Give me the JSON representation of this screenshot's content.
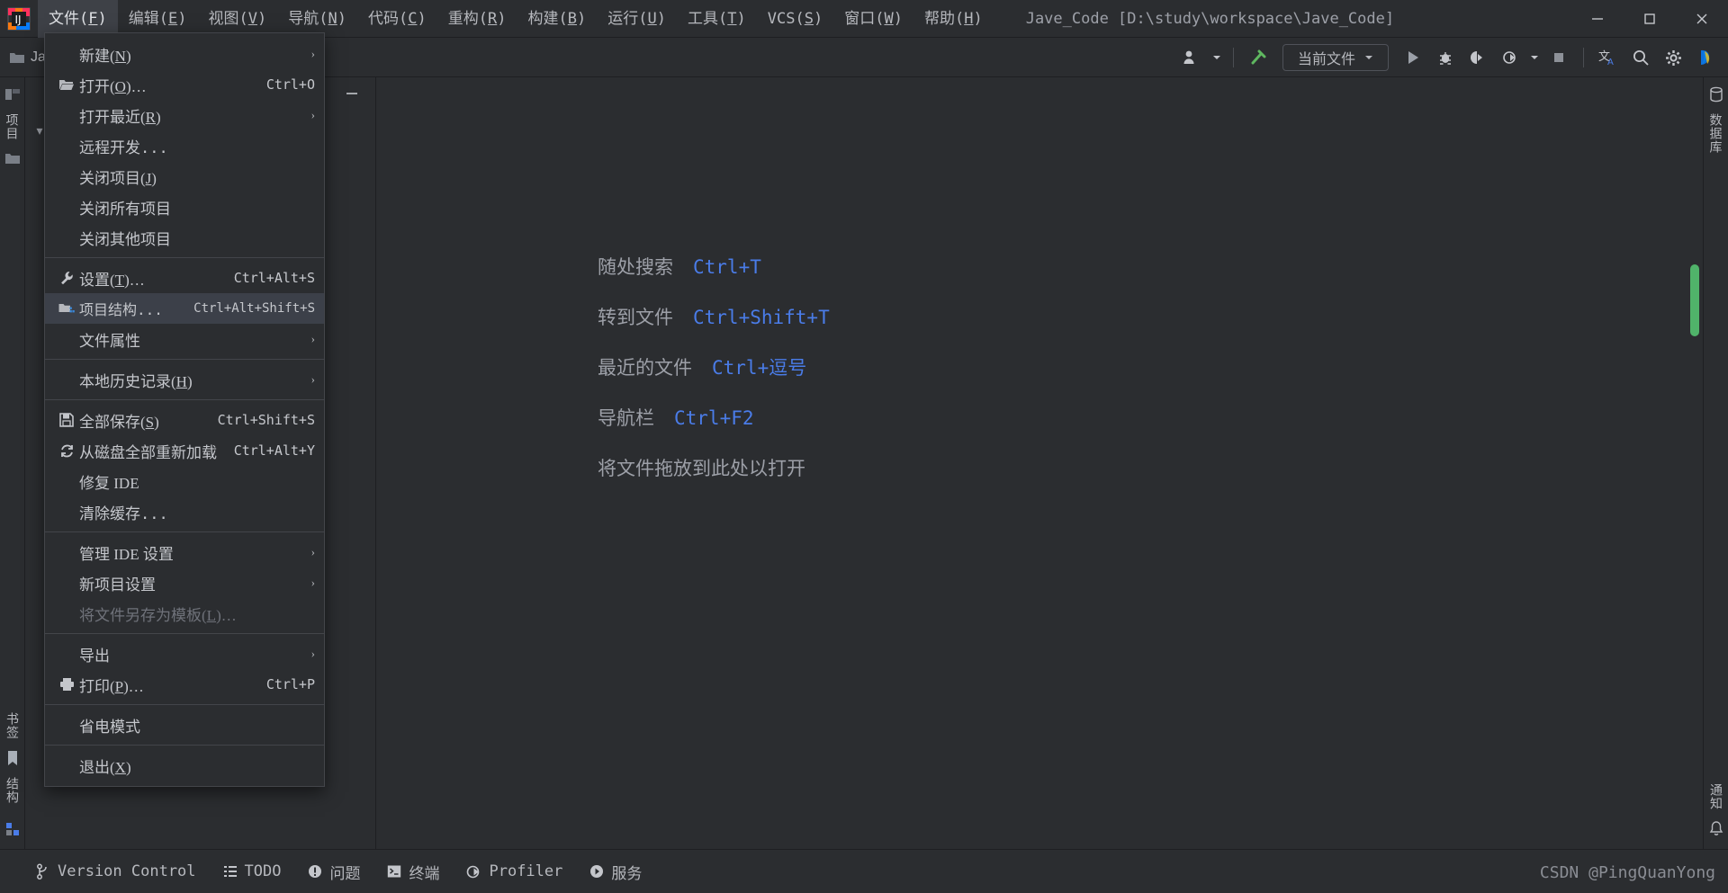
{
  "window": {
    "title": "Jave_Code [D:\\study\\workspace\\Jave_Code]",
    "minimize_label": "—",
    "maximize_label": "▭",
    "close_label": "✕"
  },
  "menubar": {
    "items": [
      {
        "label": "文件(F)",
        "text": "文件(",
        "mnemonic": "F",
        "tail": ")",
        "active": true
      },
      {
        "label": "编辑(E)",
        "text": "编辑(",
        "mnemonic": "E",
        "tail": ")",
        "active": false
      },
      {
        "label": "视图(V)",
        "text": "视图(",
        "mnemonic": "V",
        "tail": ")",
        "active": false
      },
      {
        "label": "导航(N)",
        "text": "导航(",
        "mnemonic": "N",
        "tail": ")",
        "active": false
      },
      {
        "label": "代码(C)",
        "text": "代码(",
        "mnemonic": "C",
        "tail": ")",
        "active": false
      },
      {
        "label": "重构(R)",
        "text": "重构(",
        "mnemonic": "R",
        "tail": ")",
        "active": false
      },
      {
        "label": "构建(B)",
        "text": "构建(",
        "mnemonic": "B",
        "tail": ")",
        "active": false
      },
      {
        "label": "运行(U)",
        "text": "运行(",
        "mnemonic": "U",
        "tail": ")",
        "active": false
      },
      {
        "label": "工具(T)",
        "text": "工具(",
        "mnemonic": "T",
        "tail": ")",
        "active": false
      },
      {
        "label": "VCS(S)",
        "text": "VCS(",
        "mnemonic": "S",
        "tail": ")",
        "active": false
      },
      {
        "label": "窗口(W)",
        "text": "窗口(",
        "mnemonic": "W",
        "tail": ")",
        "active": false
      },
      {
        "label": "帮助(H)",
        "text": "帮助(",
        "mnemonic": "H",
        "tail": ")",
        "active": false
      }
    ]
  },
  "file_menu": {
    "items": [
      {
        "label": "新建(N)",
        "pre": "新建(",
        "mn": "N",
        "post": ")",
        "shortcut": "",
        "arrow": true,
        "icon": "",
        "disabled": false,
        "highlight": false,
        "sep_after": false
      },
      {
        "label": "打开(O)…",
        "pre": "打开(",
        "mn": "O",
        "post": ")…",
        "shortcut": "Ctrl+O",
        "arrow": false,
        "icon": "folder-open-icon",
        "disabled": false,
        "highlight": false,
        "sep_after": false
      },
      {
        "label": "打开最近(R)",
        "pre": "打开最近(",
        "mn": "R",
        "post": ")",
        "shortcut": "",
        "arrow": true,
        "icon": "",
        "disabled": false,
        "highlight": false,
        "sep_after": false
      },
      {
        "label": "远程开发...",
        "pre": "远程开发...",
        "mn": "",
        "post": "",
        "shortcut": "",
        "arrow": false,
        "icon": "",
        "disabled": false,
        "highlight": false,
        "sep_after": false
      },
      {
        "label": "关闭项目(J)",
        "pre": "关闭项目(",
        "mn": "J",
        "post": ")",
        "shortcut": "",
        "arrow": false,
        "icon": "",
        "disabled": false,
        "highlight": false,
        "sep_after": false
      },
      {
        "label": "关闭所有项目",
        "pre": "关闭所有项目",
        "mn": "",
        "post": "",
        "shortcut": "",
        "arrow": false,
        "icon": "",
        "disabled": false,
        "highlight": false,
        "sep_after": false
      },
      {
        "label": "关闭其他项目",
        "pre": "关闭其他项目",
        "mn": "",
        "post": "",
        "shortcut": "",
        "arrow": false,
        "icon": "",
        "disabled": false,
        "highlight": false,
        "sep_after": true
      },
      {
        "label": "设置(T)…",
        "pre": "设置(",
        "mn": "T",
        "post": ")…",
        "shortcut": "Ctrl+Alt+S",
        "arrow": false,
        "icon": "wrench-icon",
        "disabled": false,
        "highlight": false,
        "sep_after": false
      },
      {
        "label": "项目结构...",
        "pre": "项目结构...",
        "mn": "",
        "post": "",
        "shortcut": "Ctrl+Alt+Shift+S",
        "arrow": false,
        "icon": "project-structure-icon",
        "disabled": false,
        "highlight": true,
        "sep_after": false
      },
      {
        "label": "文件属性",
        "pre": "文件属性",
        "mn": "",
        "post": "",
        "shortcut": "",
        "arrow": true,
        "icon": "",
        "disabled": false,
        "highlight": false,
        "sep_after": true
      },
      {
        "label": "本地历史记录(H)",
        "pre": "本地历史记录(",
        "mn": "H",
        "post": ")",
        "shortcut": "",
        "arrow": true,
        "icon": "",
        "disabled": false,
        "highlight": false,
        "sep_after": true
      },
      {
        "label": "全部保存(S)",
        "pre": "全部保存(",
        "mn": "S",
        "post": ")",
        "shortcut": "Ctrl+Shift+S",
        "arrow": false,
        "icon": "save-icon",
        "disabled": false,
        "highlight": false,
        "sep_after": false
      },
      {
        "label": "从磁盘全部重新加载",
        "pre": "从磁盘全部重新加载",
        "mn": "",
        "post": "",
        "shortcut": "Ctrl+Alt+Y",
        "arrow": false,
        "icon": "reload-icon",
        "disabled": false,
        "highlight": false,
        "sep_after": false
      },
      {
        "label": "修复 IDE",
        "pre": "修复 IDE",
        "mn": "",
        "post": "",
        "shortcut": "",
        "arrow": false,
        "icon": "",
        "disabled": false,
        "highlight": false,
        "sep_after": false
      },
      {
        "label": "清除缓存...",
        "pre": "清除缓存...",
        "mn": "",
        "post": "",
        "shortcut": "",
        "arrow": false,
        "icon": "",
        "disabled": false,
        "highlight": false,
        "sep_after": true
      },
      {
        "label": "管理 IDE 设置",
        "pre": "管理 IDE 设置",
        "mn": "",
        "post": "",
        "shortcut": "",
        "arrow": true,
        "icon": "",
        "disabled": false,
        "highlight": false,
        "sep_after": false
      },
      {
        "label": "新项目设置",
        "pre": "新项目设置",
        "mn": "",
        "post": "",
        "shortcut": "",
        "arrow": true,
        "icon": "",
        "disabled": false,
        "highlight": false,
        "sep_after": false
      },
      {
        "label": "将文件另存为模板(L)…",
        "pre": "将文件另存为模板(",
        "mn": "L",
        "post": ")…",
        "shortcut": "",
        "arrow": false,
        "icon": "",
        "disabled": true,
        "highlight": false,
        "sep_after": true
      },
      {
        "label": "导出",
        "pre": "导出",
        "mn": "",
        "post": "",
        "shortcut": "",
        "arrow": true,
        "icon": "",
        "disabled": false,
        "highlight": false,
        "sep_after": false
      },
      {
        "label": "打印(P)…",
        "pre": "打印(",
        "mn": "P",
        "post": ")…",
        "shortcut": "Ctrl+P",
        "arrow": false,
        "icon": "printer-icon",
        "disabled": false,
        "highlight": false,
        "sep_after": true
      },
      {
        "label": "省电模式",
        "pre": "省电模式",
        "mn": "",
        "post": "",
        "shortcut": "",
        "arrow": false,
        "icon": "",
        "disabled": false,
        "highlight": false,
        "sep_after": true
      },
      {
        "label": "退出(X)",
        "pre": "退出(",
        "mn": "X",
        "post": ")",
        "shortcut": "",
        "arrow": false,
        "icon": "",
        "disabled": false,
        "highlight": false,
        "sep_after": false
      }
    ]
  },
  "toolbar": {
    "run_config_label": "当前文件",
    "icons": [
      {
        "name": "user-account-icon"
      },
      {
        "name": "build-hammer-icon"
      },
      {
        "name": "run-icon"
      },
      {
        "name": "debug-icon"
      },
      {
        "name": "run-with-coverage-icon"
      },
      {
        "name": "profiler-run-icon"
      },
      {
        "name": "stop-icon"
      },
      {
        "name": "translate-icon"
      },
      {
        "name": "search-everywhere-icon"
      },
      {
        "name": "settings-gear-icon"
      },
      {
        "name": "ai-assistant-icon"
      }
    ]
  },
  "project_panel": {
    "title": "项目",
    "tree_root": "Jave_Code",
    "header_icons": [
      "gear-icon",
      "collapse-icon"
    ]
  },
  "left_strip": {
    "labels": [
      "项目",
      "结构",
      "书签"
    ]
  },
  "right_strip": {
    "labels": [
      "数据库",
      "通知"
    ]
  },
  "editor": {
    "hints": [
      {
        "label": "随处搜索",
        "key": "Ctrl+T"
      },
      {
        "label": "转到文件",
        "key": "Ctrl+Shift+T"
      },
      {
        "label": "最近的文件",
        "key": "Ctrl+逗号"
      },
      {
        "label": "导航栏",
        "key": "Ctrl+F2"
      }
    ],
    "drop_hint": "将文件拖放到此处以打开"
  },
  "statusbar": {
    "items": [
      {
        "label": "Version Control",
        "icon": "branch-icon"
      },
      {
        "label": "TODO",
        "icon": "todo-list-icon"
      },
      {
        "label": "问题",
        "icon": "problems-icon"
      },
      {
        "label": "终端",
        "icon": "terminal-icon"
      },
      {
        "label": "Profiler",
        "icon": "profiler-icon"
      },
      {
        "label": "服务",
        "icon": "services-icon"
      }
    ],
    "watermark": "CSDN @PingQuanYong"
  },
  "colors": {
    "bg": "#2b2d30",
    "menu_bg": "#2b2d30",
    "menu_border": "#43454a",
    "highlight": "#3c4049",
    "accent_blue": "#4a7ce8",
    "text": "#c5c7cc",
    "muted": "#9da0a8",
    "scrollbar_green": "#50b36a"
  }
}
